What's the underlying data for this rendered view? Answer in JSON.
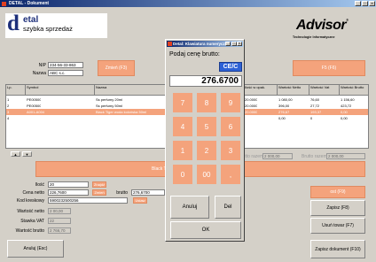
{
  "window": {
    "title": "DETAL - Dokument"
  },
  "logo": {
    "d": "d",
    "brand": "etal",
    "subtitle": "szybka sprzedaż"
  },
  "advisor": {
    "name": "Advisor",
    "reg": "®",
    "tagline": "Technologie Informatyczne"
  },
  "customer": {
    "nip_label": "NIP",
    "nip_value": "234-56-33-863",
    "name_label": "Nazwa",
    "name_value": "ABC s.c."
  },
  "buttons": {
    "client": "Zmień (F3)",
    "f6": "F5 (F6)",
    "cancel": "Anuluj (Esc)",
    "save": "Zapisz (F8)",
    "remove": "Usuń towar (F7)",
    "close_doc": "Zapisz dokument (F10)",
    "f9": "ost (F9)",
    "find": "Znajdź",
    "edit": "Zmień",
    "set": "Ustaw"
  },
  "table": {
    "headers": [
      "Lp.",
      "Symbol",
      "Nazwa",
      "Ilość w opak.",
      "Wartość Netto",
      "Wartość Vat",
      "Wartość Brutto"
    ],
    "rows": [
      [
        "1",
        "PE00500",
        "Ss perfumy 20ml",
        "20.0000",
        "1 080,00",
        "76,60",
        "1 156,60"
      ],
      [
        "2",
        "PE00500",
        "Ss perfumy 50ml",
        "20.0000",
        "396,00",
        "27,72",
        "423,72"
      ],
      [
        "3",
        "A001-A004",
        "Black Tiger woda kolońska 50ml",
        "20.0000",
        "276,67",
        "193,37",
        "0,00"
      ],
      [
        "4",
        "",
        "",
        "",
        "0,00",
        "0",
        "0,00"
      ]
    ],
    "summary_netto_label": "Netto razem",
    "summary_brutto_label": "Brutto razem",
    "summary_netto": "2 000,00",
    "summary_brutto": "2 000,00"
  },
  "detail": {
    "product_name": "Black Tiger woda kolońska",
    "fields": [
      {
        "label": "Ilość",
        "value": "20"
      },
      {
        "label": "Cena netto",
        "value": "226,7600"
      },
      {
        "label": "Kod kreskowy",
        "value": "5900232500256"
      },
      {
        "label": "Wartość netto",
        "value": "2 00,00"
      },
      {
        "label": "Stawka VAT",
        "value": "22"
      },
      {
        "label": "Wartość brutto",
        "value": "2 766,70"
      }
    ],
    "brutto_label": "brutto",
    "brutto_value": "276,6700"
  },
  "dialog": {
    "title": "Detal: Klawiatura numeryczna",
    "prompt": "Podaj cenę brutto:",
    "clear": "CE/C",
    "display": "276.6700",
    "keys": [
      "7",
      "8",
      "9",
      "4",
      "5",
      "6",
      "1",
      "2",
      "3",
      "0",
      "00",
      ","
    ],
    "cancel": "Anuluj",
    "del": "Del",
    "ok": "OK"
  }
}
